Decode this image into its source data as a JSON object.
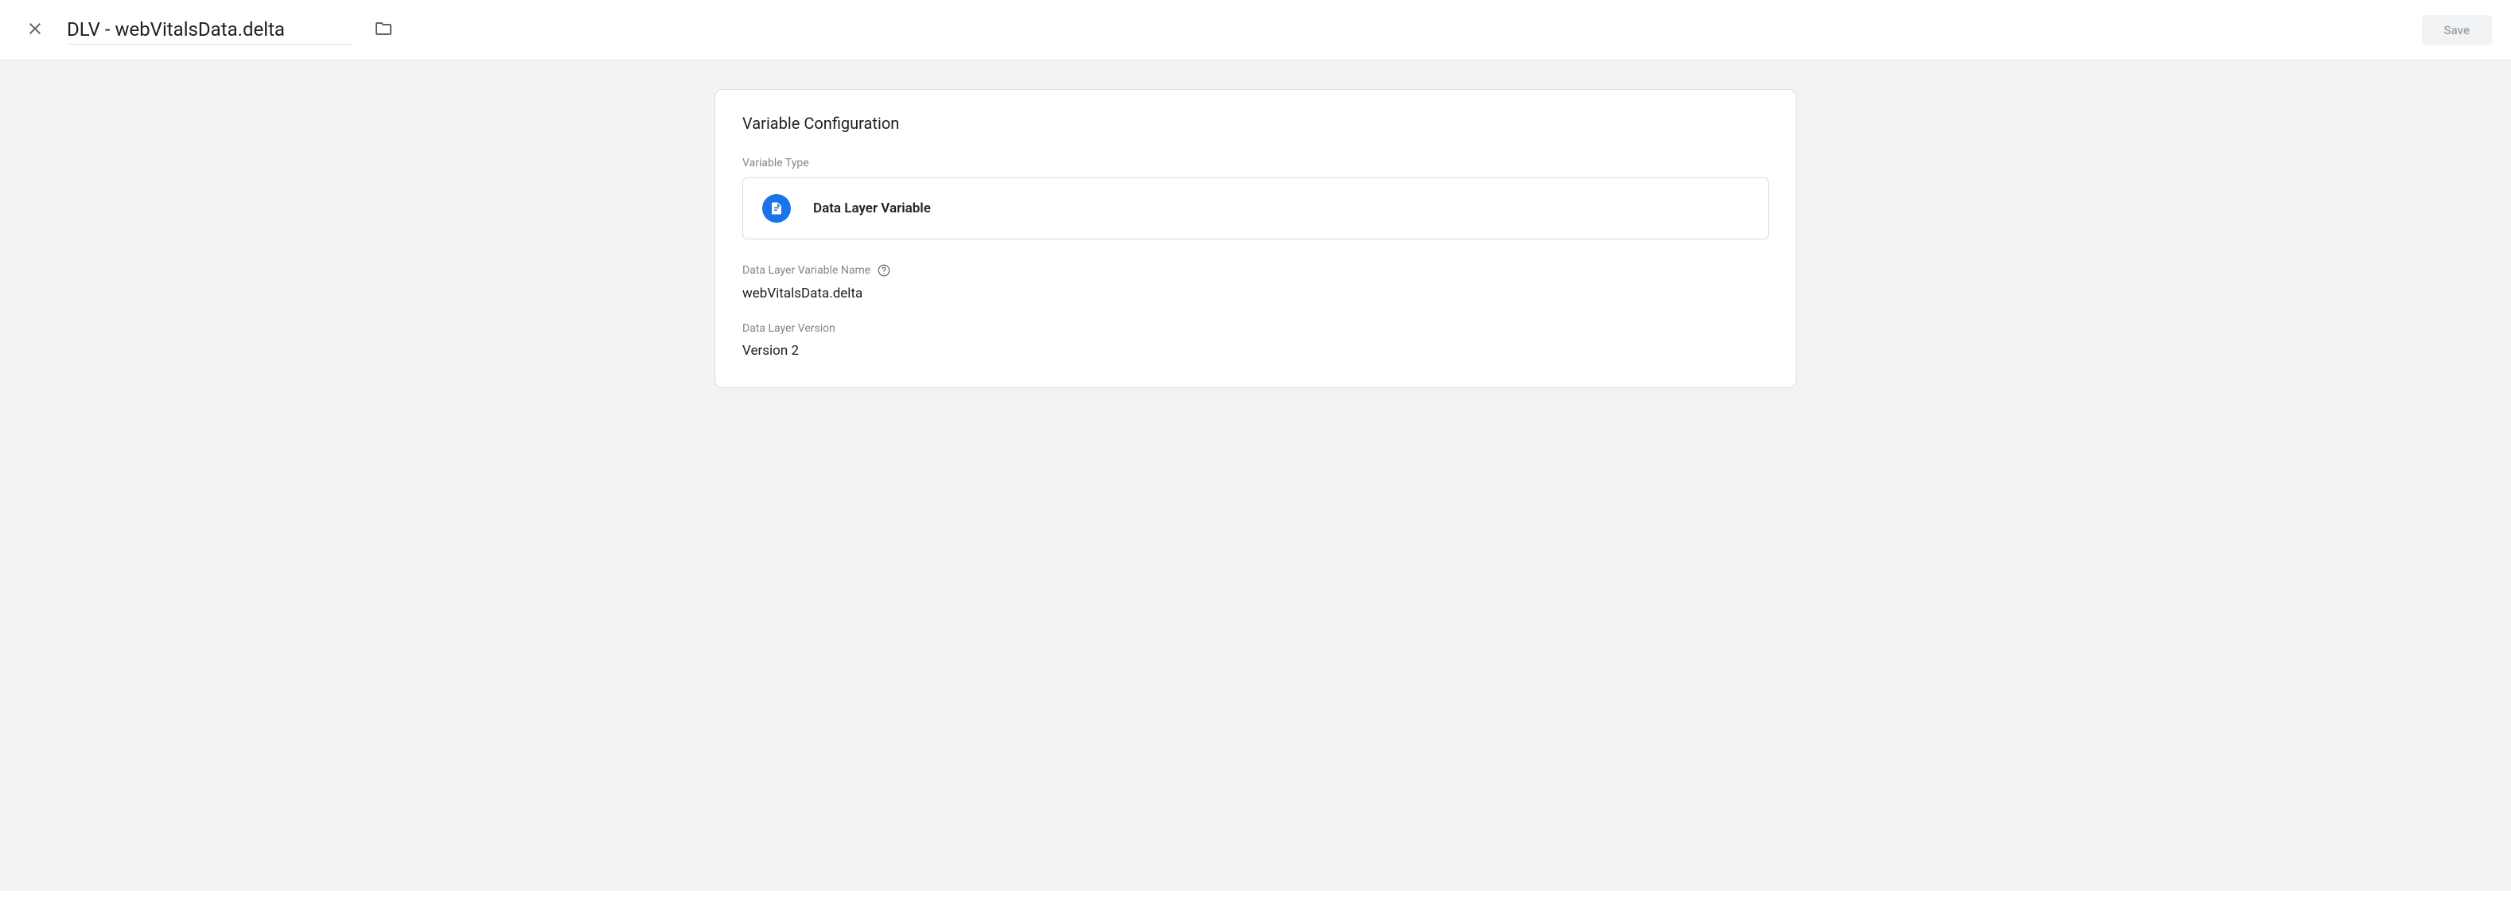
{
  "header": {
    "title": "DLV - webVitalsData.delta",
    "save_label": "Save"
  },
  "card": {
    "section_title": "Variable Configuration",
    "variable_type_label": "Variable Type",
    "variable_type_name": "Data Layer Variable",
    "dlv_name_label": "Data Layer Variable Name",
    "dlv_name_value": "webVitalsData.delta",
    "dlv_version_label": "Data Layer Version",
    "dlv_version_value": "Version 2"
  }
}
